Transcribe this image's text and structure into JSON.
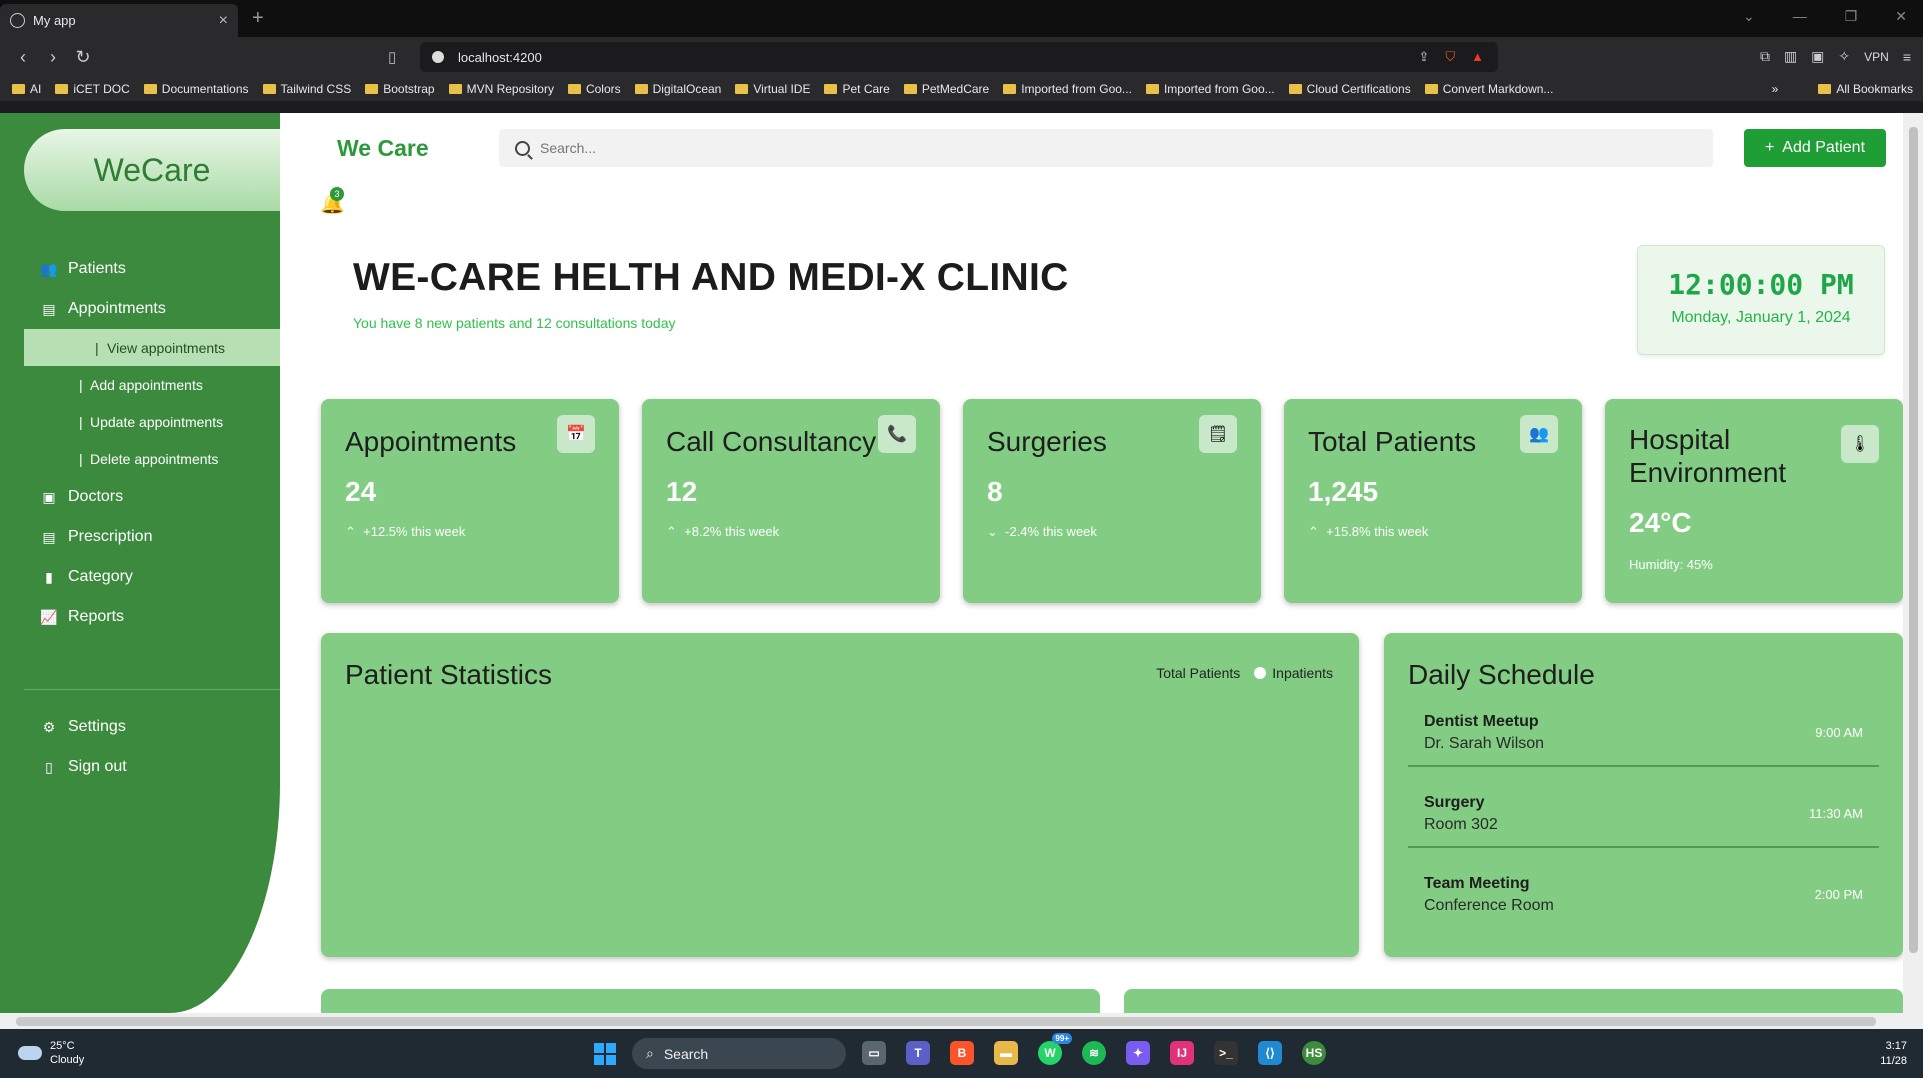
{
  "browser": {
    "tab_title": "My app",
    "url": "localhost:4200",
    "vpn_label": "VPN",
    "bookmarks": [
      "AI",
      "iCET DOC",
      "Documentations",
      "Tailwind CSS",
      "Bootstrap",
      "MVN Repository",
      "Colors",
      "DigitalOcean",
      "Virtual IDE",
      "Pet Care",
      "PetMedCare",
      "Imported from Goo...",
      "Imported from Goo...",
      "Cloud Certifications",
      "Convert Markdown..."
    ],
    "all_bookmarks": "All Bookmarks",
    "more_label": "»"
  },
  "sidebar": {
    "logo": "WeCare",
    "items": [
      {
        "label": "Patients",
        "icon": "users-icon"
      },
      {
        "label": "Appointments",
        "icon": "file-icon"
      }
    ],
    "subitems": [
      "View appointments",
      "Add appointments",
      "Update appointments",
      "Delete appointments"
    ],
    "items_after": [
      {
        "label": "Doctors",
        "icon": "id-card-icon"
      },
      {
        "label": "Prescription",
        "icon": "file-icon"
      },
      {
        "label": "Category",
        "icon": "bookmark-icon"
      },
      {
        "label": "Reports",
        "icon": "chart-icon"
      }
    ],
    "bottom": [
      {
        "label": "Settings",
        "icon": "gear-icon"
      },
      {
        "label": "Sign out",
        "icon": "door-icon"
      }
    ]
  },
  "header": {
    "brand": "We Care",
    "search_placeholder": "Search...",
    "add_button": "Add Patient",
    "notification_count": "3"
  },
  "hero": {
    "title": "WE-CARE HELTH AND MEDI-X CLINIC",
    "subtitle": "You have 8 new patients and 12 consultations today",
    "time": "12:00:00 PM",
    "date": "Monday, January 1, 2024"
  },
  "stats": [
    {
      "title": "Appointments",
      "value": "24",
      "change": "+12.5% this week",
      "trend": "up",
      "icon": "calendar-icon"
    },
    {
      "title": "Call Consultancy",
      "value": "12",
      "change": "+8.2% this week",
      "trend": "up",
      "icon": "phone-icon"
    },
    {
      "title": "Surgeries",
      "value": "8",
      "change": "-2.4% this week",
      "trend": "down",
      "icon": "clipboard-icon"
    },
    {
      "title": "Total Patients",
      "value": "1,245",
      "change": "+15.8% this week",
      "trend": "up",
      "icon": "users-icon"
    },
    {
      "title": "Hospital Environment",
      "value": "24°C",
      "change": "Humidity: 45%",
      "trend": "none",
      "icon": "thermometer-icon"
    }
  ],
  "patient_stats": {
    "title": "Patient Statistics",
    "legend": [
      "Total Patients",
      "Inpatients"
    ]
  },
  "schedule": {
    "title": "Daily Schedule",
    "items": [
      {
        "name": "Dentist Meetup",
        "place": "Dr. Sarah Wilson",
        "time": "9:00 AM"
      },
      {
        "name": "Surgery",
        "place": "Room 302",
        "time": "11:30 AM"
      },
      {
        "name": "Team Meeting",
        "place": "Conference Room",
        "time": "2:00 PM"
      }
    ]
  },
  "taskbar": {
    "temp": "25°C",
    "weather": "Cloudy",
    "search": "Search",
    "notification_badge": "99+",
    "time": "3:17",
    "date": "11/28"
  },
  "colors": {
    "sidebar": "#3b8a3d",
    "card": "#82cd83",
    "accent": "#1e9e34"
  }
}
